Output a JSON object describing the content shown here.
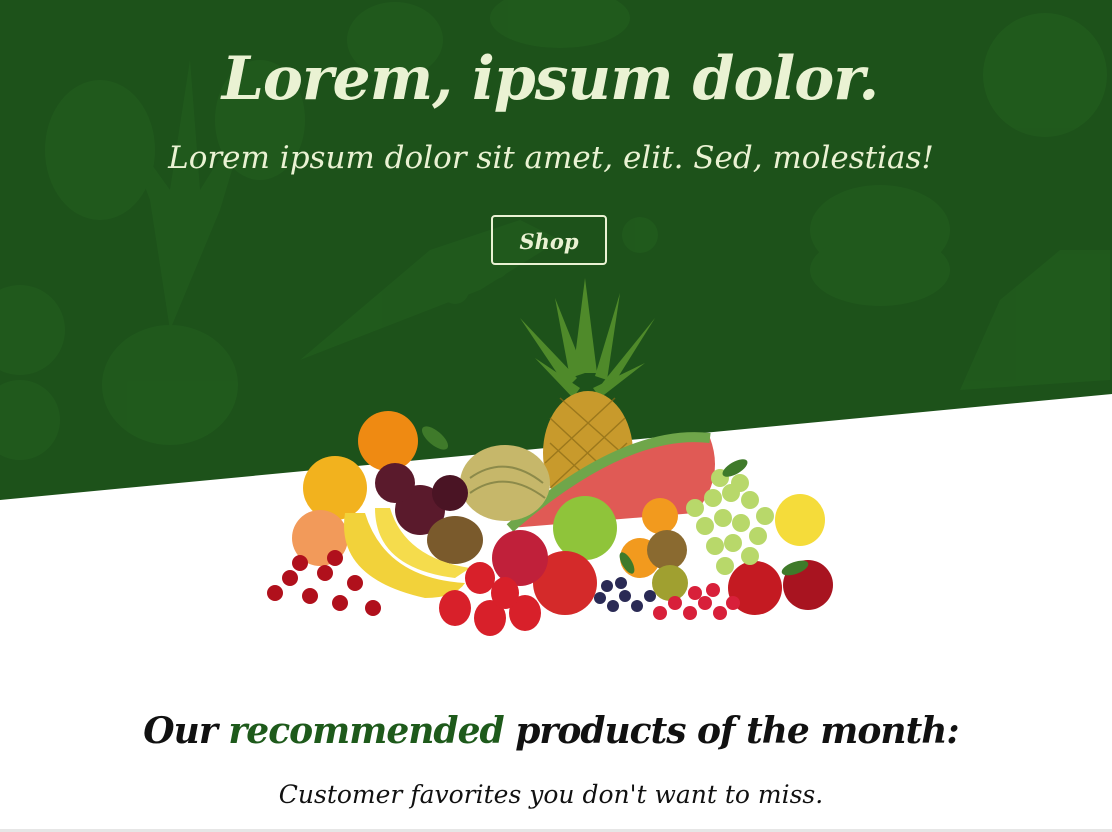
{
  "hero": {
    "title": "Lorem, ipsum dolor.",
    "subtitle": "Lorem ipsum dolor sit amet, elit. Sed, molestias!",
    "shop_label": "Shop",
    "background_color": "#1d521a",
    "text_color": "#eaf2d3"
  },
  "featured_image": {
    "subject": "fruit-assortment"
  },
  "recommended": {
    "heading_before": "Our ",
    "heading_accent": "recommended",
    "heading_after": " products of the month:",
    "subheading": "Customer favorites you don't want to miss.",
    "accent_color": "#1e5a1b"
  }
}
